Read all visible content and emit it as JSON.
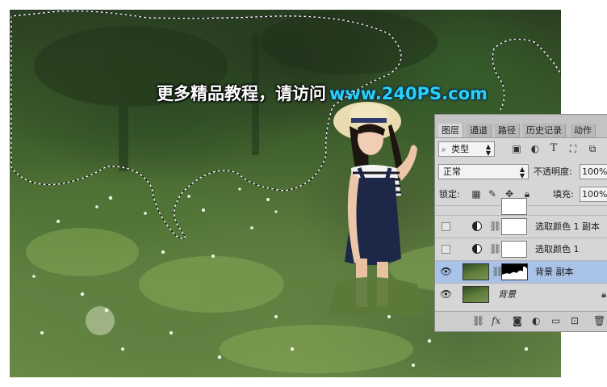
{
  "watermark": {
    "chinese": "更多精品教程，请访问",
    "url": "www.240PS.com"
  },
  "layers_panel": {
    "tabs": [
      "图层",
      "通道",
      "路径",
      "历史记录",
      "动作"
    ],
    "active_tab": "图层",
    "filter": {
      "label": "类型",
      "icons": [
        "image-filter-icon",
        "adjustment-filter-icon",
        "type-filter-icon",
        "shape-filter-icon",
        "smart-object-filter-icon"
      ],
      "type_icon_glyph": "T"
    },
    "blend_mode": "正常",
    "opacity_label": "不透明度:",
    "opacity_value": "100%",
    "lock_label": "锁定:",
    "fill_label": "填充:",
    "fill_value": "100%",
    "layers": [
      {
        "name": "选取颜色 1 副本",
        "visible": false,
        "type": "adjustment",
        "selected": false
      },
      {
        "name": "选取颜色 1",
        "visible": false,
        "type": "adjustment",
        "selected": false
      },
      {
        "name": "背景 副本",
        "visible": true,
        "type": "photo-with-mask",
        "selected": true
      },
      {
        "name": "背景",
        "visible": true,
        "type": "background",
        "selected": false
      }
    ],
    "bottom_icons": [
      "link-icon",
      "fx-icon",
      "mask-icon",
      "adjustment-icon",
      "folder-icon",
      "new-layer-icon",
      "trash-icon"
    ],
    "fx_text": "fx"
  },
  "colors": {
    "selection_highlight": "#a9c2e8",
    "watermark_url": "#2ad0f5",
    "panel_bg": "#d6d6d6"
  }
}
